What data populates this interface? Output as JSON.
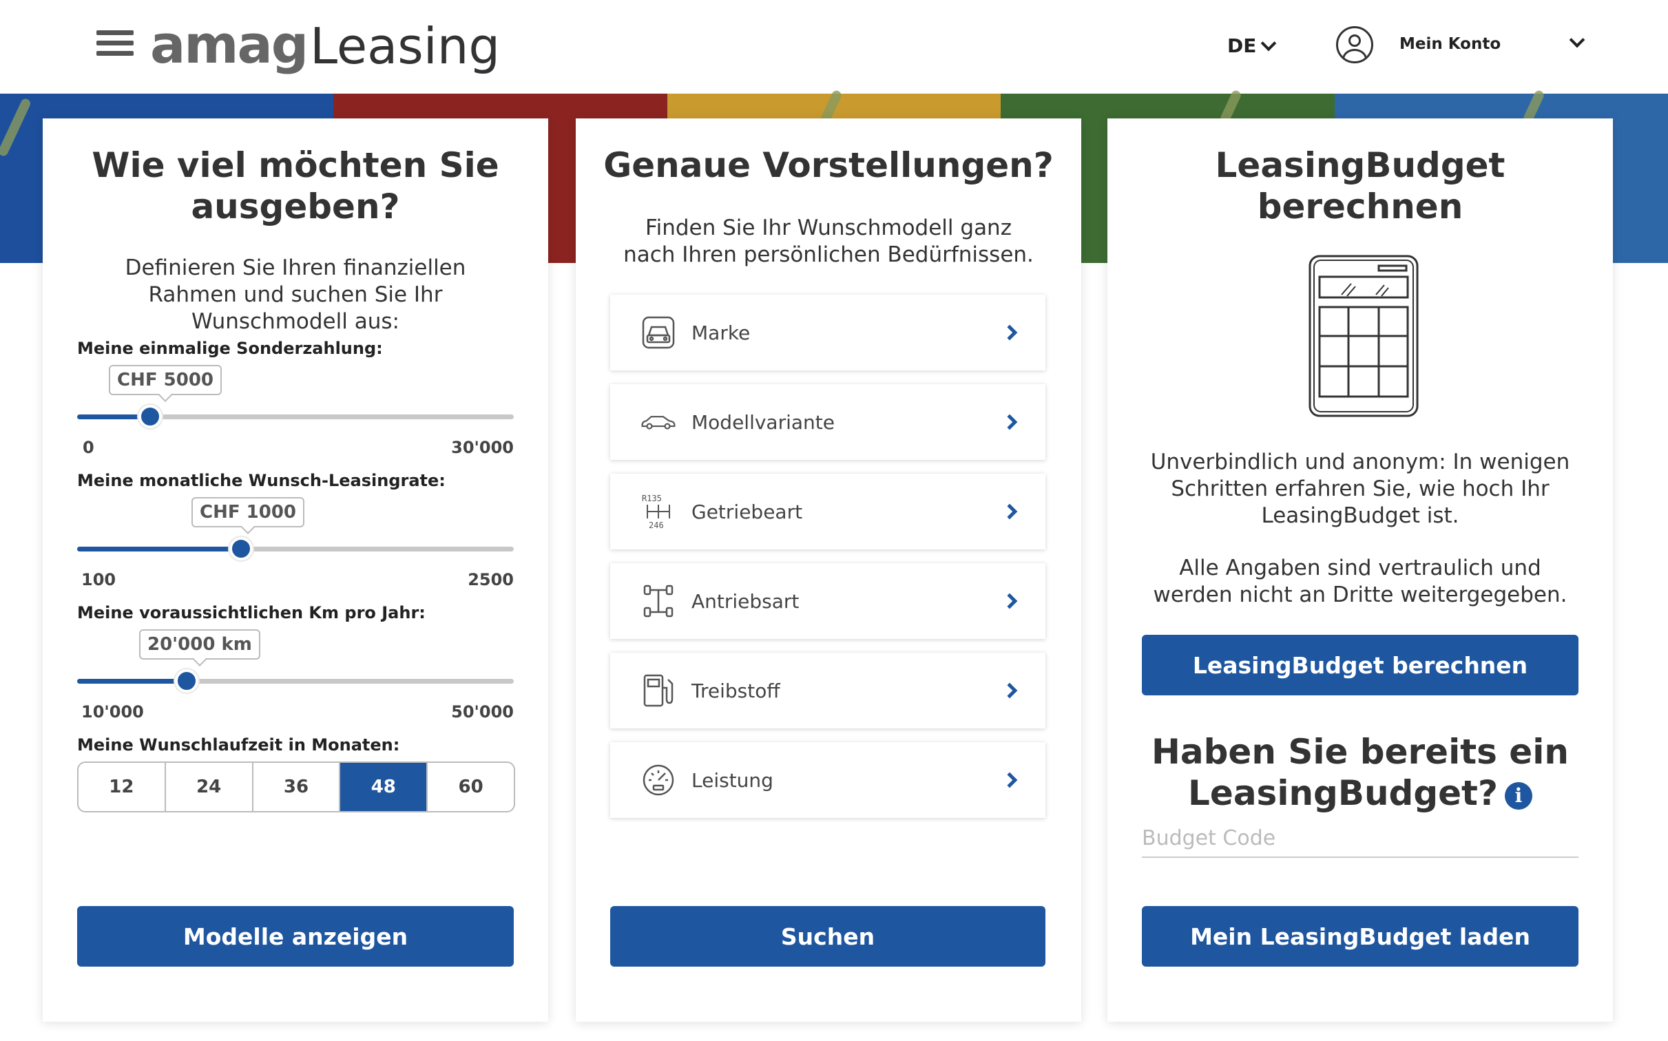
{
  "header": {
    "logo_brand": "amag",
    "logo_product": "Leasing",
    "language": "DE",
    "account_label": "Mein Konto"
  },
  "colors": {
    "primary": "#1e56a0",
    "banner": [
      "#1d4f9c",
      "#8b2420",
      "#c99a2e",
      "#3d6b32",
      "#2e67a8"
    ]
  },
  "budget_card": {
    "title": "Wie viel möchten Sie ausgeben?",
    "intro": "Definieren Sie Ihren finanziellen Rahmen und suchen Sie Ihr Wunschmodell aus:",
    "sliders": [
      {
        "label": "Meine einmalige Sonderzahlung:",
        "value_text": "CHF 5000",
        "min": "0",
        "max": "30'000",
        "fraction": 0.167
      },
      {
        "label": "Meine monatliche Wunsch-Leasingrate:",
        "value_text": "CHF 1000",
        "min": "100",
        "max": "2500",
        "fraction": 0.375
      },
      {
        "label": "Meine voraussichtlichen Km pro Jahr:",
        "value_text": "20'000 km",
        "min": "10'000",
        "max": "50'000",
        "fraction": 0.25
      }
    ],
    "months_label": "Meine Wunschlaufzeit in Monaten:",
    "months": [
      "12",
      "24",
      "36",
      "48",
      "60"
    ],
    "months_selected": "48",
    "button": "Modelle anzeigen"
  },
  "search_card": {
    "title": "Genaue Vorstellungen?",
    "intro": "Finden Sie Ihr Wunschmodell ganz nach Ihren persönlichen Bedürfnissen.",
    "filters": [
      {
        "label": "Marke",
        "icon": "car-front-icon"
      },
      {
        "label": "Modellvariante",
        "icon": "car-side-icon"
      },
      {
        "label": "Getriebeart",
        "icon": "gearshift-icon"
      },
      {
        "label": "Antriebsart",
        "icon": "drivetrain-icon"
      },
      {
        "label": "Treibstoff",
        "icon": "fuel-pump-icon"
      },
      {
        "label": "Leistung",
        "icon": "speedometer-icon"
      }
    ],
    "gear_text_top": "R135",
    "gear_text_bottom": "246",
    "button": "Suchen"
  },
  "leasing_card": {
    "title": "LeasingBudget berechnen",
    "text1": "Unverbindlich und anonym: In wenigen Schritten erfahren Sie, wie hoch Ihr LeasingBudget ist.",
    "text2": "Alle Angaben sind vertraulich und werden nicht an Dritte weitergegeben.",
    "calc_button": "LeasingBudget berechnen",
    "question": "Haben Sie bereits ein LeasingBudget?",
    "info_glyph": "i",
    "input_placeholder": "Budget Code",
    "load_button": "Mein LeasingBudget laden"
  }
}
